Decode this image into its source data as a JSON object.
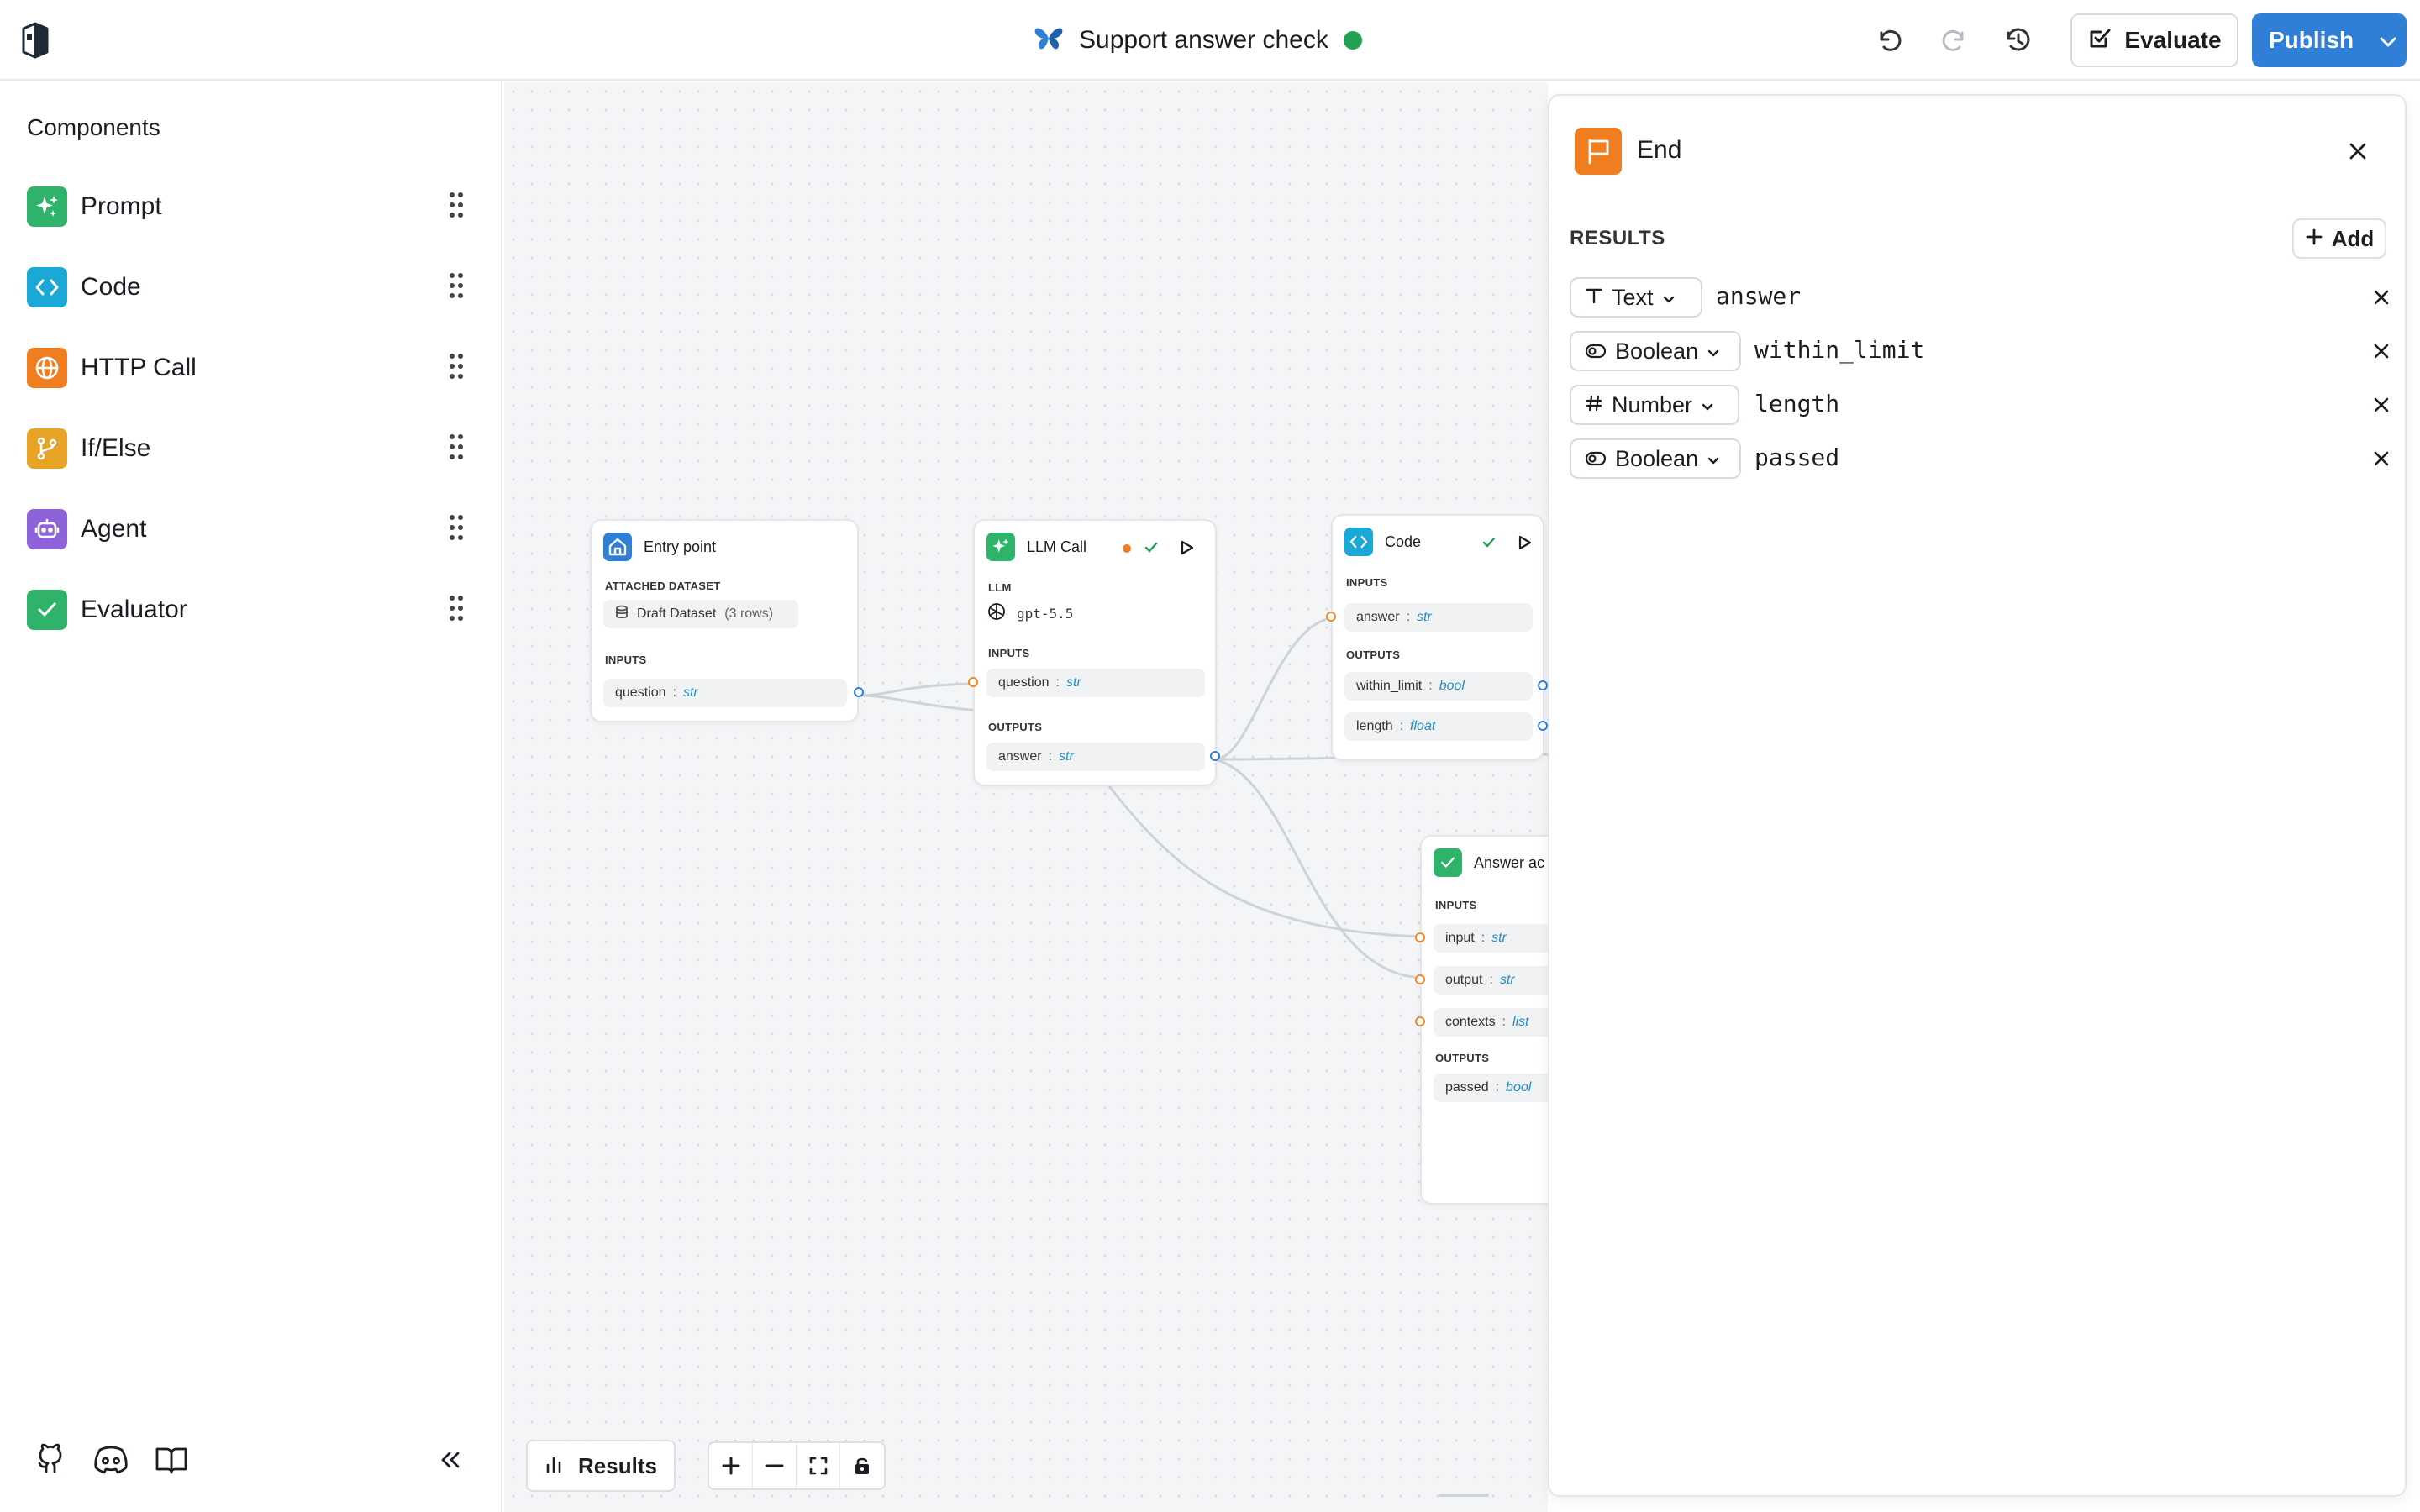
{
  "header": {
    "title": "Support answer check",
    "status_color": "#22a155",
    "evaluate_label": "Evaluate",
    "publish_label": "Publish",
    "accent": "#2f7fd6"
  },
  "sidebar": {
    "title": "Components",
    "items": [
      {
        "label": "Prompt",
        "icon": "sparkle-icon",
        "color": "#2fb36a"
      },
      {
        "label": "Code",
        "icon": "code-icon",
        "color": "#1aa9d6"
      },
      {
        "label": "HTTP Call",
        "icon": "globe-icon",
        "color": "#f07d1f"
      },
      {
        "label": "If/Else",
        "icon": "branch-icon",
        "color": "#e8a325"
      },
      {
        "label": "Agent",
        "icon": "robot-icon",
        "color": "#8e63d9"
      },
      {
        "label": "Evaluator",
        "icon": "check-icon",
        "color": "#2fb36a"
      }
    ]
  },
  "canvas": {
    "entry": {
      "title": "Entry point",
      "dataset_section": "ATTACHED DATASET",
      "dataset_name": "Draft Dataset",
      "dataset_rows": "(3 rows)",
      "inputs_section": "INPUTS",
      "inputs": [
        {
          "name": "question",
          "type": "str"
        }
      ]
    },
    "llm": {
      "title": "LLM Call",
      "llm_section": "LLM",
      "model": "gpt-5.5",
      "inputs_section": "INPUTS",
      "inputs": [
        {
          "name": "question",
          "type": "str"
        }
      ],
      "outputs_section": "OUTPUTS",
      "outputs": [
        {
          "name": "answer",
          "type": "str"
        }
      ]
    },
    "code": {
      "title": "Code",
      "inputs_section": "INPUTS",
      "inputs": [
        {
          "name": "answer",
          "type": "str"
        }
      ],
      "outputs_section": "OUTPUTS",
      "outputs": [
        {
          "name": "within_limit",
          "type": "bool"
        },
        {
          "name": "length",
          "type": "float"
        }
      ]
    },
    "evaluator": {
      "title": "Answer ac",
      "inputs_section": "INPUTS",
      "inputs": [
        {
          "name": "input",
          "type": "str"
        },
        {
          "name": "output",
          "type": "str"
        },
        {
          "name": "contexts",
          "type": "list"
        }
      ],
      "outputs_section": "OUTPUTS",
      "outputs": [
        {
          "name": "passed",
          "type": "bool"
        }
      ]
    },
    "results_label": "Results"
  },
  "panel": {
    "title": "End",
    "results_section": "RESULTS",
    "add_label": "Add",
    "results": [
      {
        "type": "Text",
        "type_icon": "text-icon",
        "name": "answer"
      },
      {
        "type": "Boolean",
        "type_icon": "toggle-icon",
        "name": "within_limit"
      },
      {
        "type": "Number",
        "type_icon": "hash-icon",
        "name": "length"
      },
      {
        "type": "Boolean",
        "type_icon": "toggle-icon",
        "name": "passed"
      }
    ]
  }
}
